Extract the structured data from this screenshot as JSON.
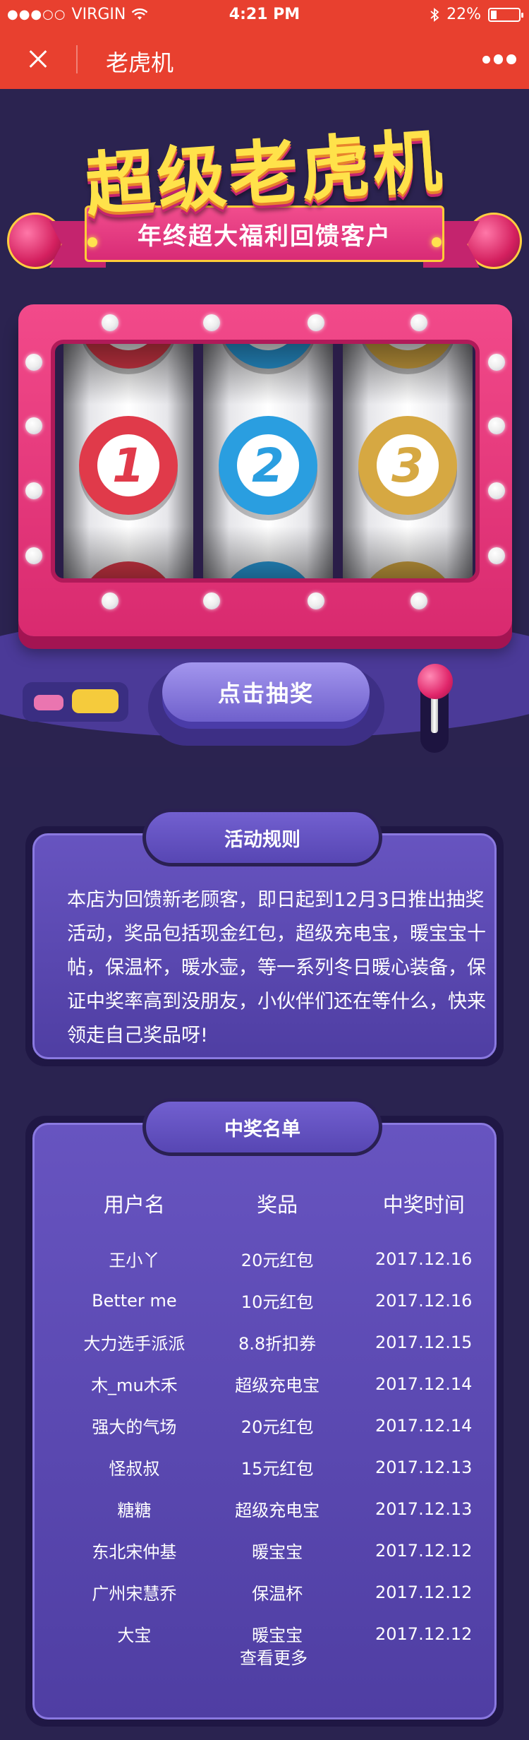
{
  "status_bar": {
    "signal": "●●●○○",
    "carrier": "VIRGIN",
    "time": "4:21 PM",
    "battery_percent": "22%",
    "battery_level": 0.22
  },
  "nav": {
    "title": "老虎机"
  },
  "hero": {
    "title": "超级老虎机",
    "subtitle": "年终超大福利回馈客户",
    "reels": [
      {
        "number": "1",
        "color": "#e03a4a"
      },
      {
        "number": "2",
        "color": "#2a9ee0"
      },
      {
        "number": "3",
        "color": "#d6a842"
      }
    ],
    "draw_button": "点击抽奖"
  },
  "rules": {
    "title": "活动规则",
    "text": "本店为回馈新老顾客，即日起到12月3日推出抽奖活动，奖品包括现金红包，超级充电宝，暖宝宝十帖，保温杯，暖水壶，等一系列冬日暖心装备，保证中奖率高到没朋友，小伙伴们还在等什么，快来领走自己奖品呀!"
  },
  "winners": {
    "title": "中奖名单",
    "columns": [
      "用户名",
      "奖品",
      "中奖时间"
    ],
    "rows": [
      {
        "user": "王小丫",
        "prize": "20元红包",
        "time": "2017.12.16"
      },
      {
        "user": "Better me",
        "prize": "10元红包",
        "time": "2017.12.16"
      },
      {
        "user": "大力选手派派",
        "prize": "8.8折扣券",
        "time": "2017.12.15"
      },
      {
        "user": "木_mu木禾",
        "prize": "超级充电宝",
        "time": "2017.12.14"
      },
      {
        "user": "强大的气场",
        "prize": "20元红包",
        "time": "2017.12.14"
      },
      {
        "user": "怪叔叔",
        "prize": "15元红包",
        "time": "2017.12.13"
      },
      {
        "user": "糖糖",
        "prize": "超级充电宝",
        "time": "2017.12.13"
      },
      {
        "user": "东北宋仲基",
        "prize": "暖宝宝",
        "time": "2017.12.12"
      },
      {
        "user": "广州宋慧乔",
        "prize": "保温杯",
        "time": "2017.12.12"
      },
      {
        "user": "大宝",
        "prize": "暖宝宝",
        "time": "2017.12.12"
      }
    ],
    "see_more": "查看更多"
  },
  "colors": {
    "nav_red": "#e8402f",
    "page_bg": "#2a2350",
    "machine_pink": "#e83a7e",
    "panel_purple": "#5b49b3",
    "title_yellow": "#ffe24a"
  }
}
